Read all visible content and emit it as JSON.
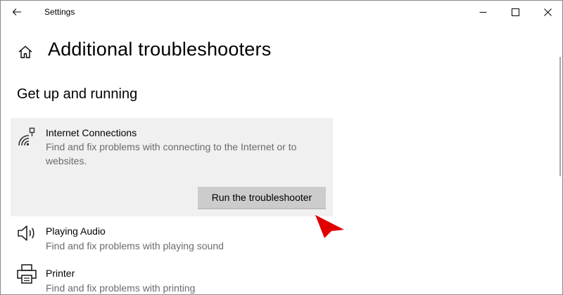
{
  "window": {
    "app_title": "Settings",
    "back_icon": "back-arrow-icon",
    "minimize_icon": "minimize-icon",
    "maximize_icon": "maximize-icon",
    "close_icon": "close-icon"
  },
  "header": {
    "home_icon": "home-icon",
    "title": "Additional troubleshooters"
  },
  "section": {
    "title": "Get up and running"
  },
  "items": [
    {
      "icon": "network-icon",
      "title": "Internet Connections",
      "description": "Find and fix problems with connecting to the Internet or to websites.",
      "action_label": "Run the troubleshooter",
      "selected": true
    },
    {
      "icon": "speaker-icon",
      "title": "Playing Audio",
      "description": "Find and fix problems with playing sound"
    },
    {
      "icon": "printer-icon",
      "title": "Printer",
      "description": "Find and fix problems with printing"
    }
  ],
  "colors": {
    "selected_bg": "#f0f0f0",
    "button_bg": "#cccccc",
    "description_text": "#6b6b6b",
    "cursor": "#e00000"
  }
}
